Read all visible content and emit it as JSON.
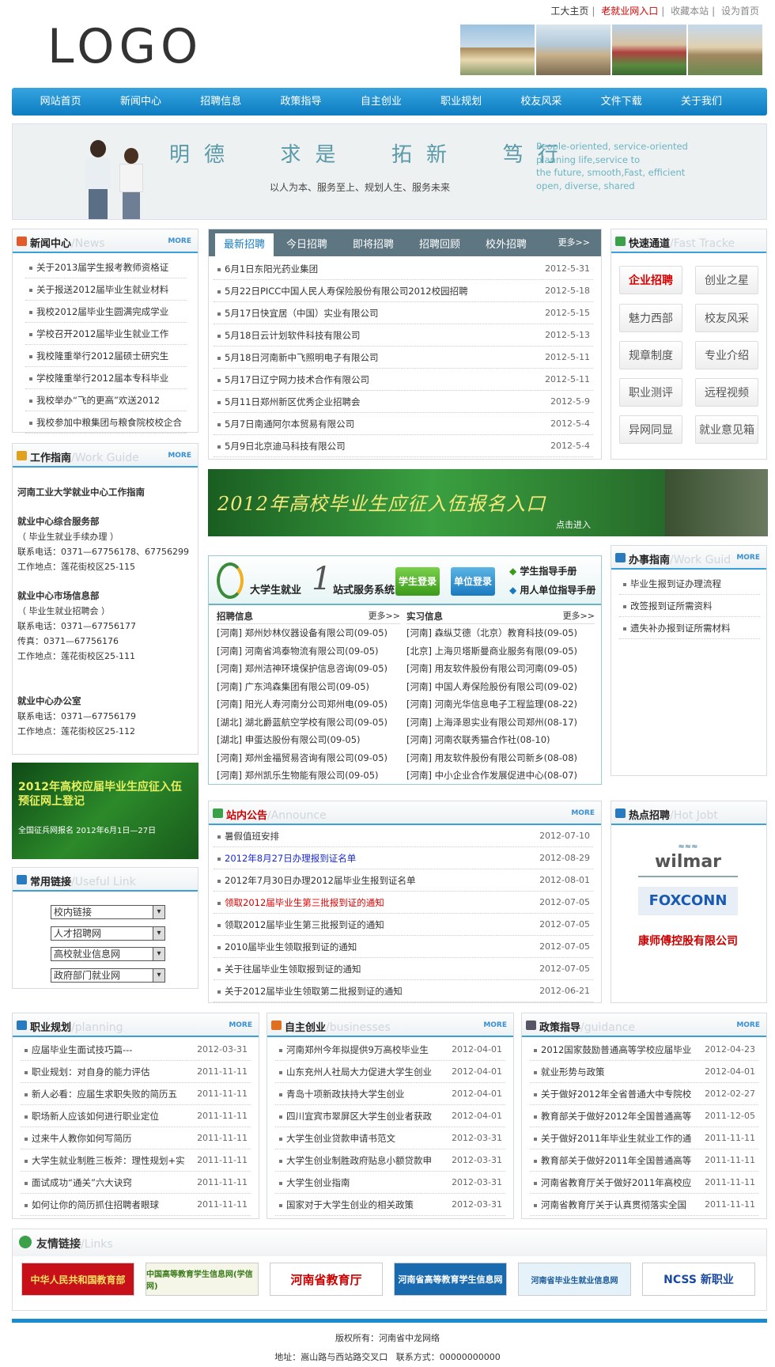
{
  "header": {
    "links": [
      "工大主页",
      "老就业网入口",
      "收藏本站",
      "设为首页"
    ],
    "logo": "LOGO"
  },
  "nav": [
    "网站首页",
    "新闻中心",
    "招聘信息",
    "政策指导",
    "自主创业",
    "职业规划",
    "校友风采",
    "文件下载",
    "关于我们"
  ],
  "banner": {
    "slogan": "明德  求是  拓新  笃行",
    "subtitle": "以人为本、服务至上、规划人生、服务未来",
    "en_lines": [
      "People-oriented, service-oriented",
      "planning life,service to",
      "the future, smooth,Fast, efficient",
      "open, diverse, shared"
    ]
  },
  "news": {
    "title": "新闻中心",
    "en": "/News",
    "more": "MORE",
    "items": [
      "关于2013届学生报考教师资格证",
      "关于报送2012届毕业生就业材料",
      "我校2012届毕业生圆满完成学业",
      "学校召开2012届毕业生就业工作",
      "我校隆重举行2012届硕士研究生",
      "学校隆重举行2012届本专科毕业",
      "我校举办“飞的更高”欢送2012",
      "我校参加中粮集团与粮食院校校企合"
    ]
  },
  "recruit": {
    "tabs": [
      "最新招聘",
      "今日招聘",
      "即将招聘",
      "招聘回顾",
      "校外招聘"
    ],
    "more": "更多>>",
    "items": [
      {
        "t": "6月1日东阳光药业集团",
        "d": "2012-5-31"
      },
      {
        "t": "5月22日PICC中国人民人寿保险股份有限公司2012校园招聘",
        "d": "2012-5-18"
      },
      {
        "t": "5月17日快宜居（中国）实业有限公司",
        "d": "2012-5-15"
      },
      {
        "t": "5月18日云计划软件科技有限公司",
        "d": "2012-5-13"
      },
      {
        "t": "5月18日河南新中飞照明电子有限公司",
        "d": "2012-5-11"
      },
      {
        "t": "5月17日辽宁网力技术合作有限公司",
        "d": "2012-5-11"
      },
      {
        "t": "5月11日郑州新区优秀企业招聘会",
        "d": "2012-5-9"
      },
      {
        "t": "5月7日南通阿尔本贸易有限公司",
        "d": "2012-5-4"
      },
      {
        "t": "5月9日北京迪马科技有限公司",
        "d": "2012-5-4"
      }
    ]
  },
  "quick": {
    "title": "快速通道",
    "en": "/Fast Tracke",
    "buttons": [
      "企业招聘",
      "创业之星",
      "魅力西部",
      "校友风采",
      "规章制度",
      "专业介绍",
      "职业测评",
      "远程视频",
      "异网同显",
      "就业意见箱"
    ]
  },
  "guide": {
    "title": "工作指南",
    "en": "/Work Guide",
    "more": "MORE",
    "heading": "河南工业大学就业中心工作指南",
    "sections": [
      {
        "name": "就业中心综合服务部",
        "lines": [
          "（ 毕业生就业手续办理 ）",
          "联系电话：0371—67756178、67756299",
          "工作地点：莲花街校区25-115"
        ]
      },
      {
        "name": "就业中心市场信息部",
        "lines": [
          "（ 毕业生就业招聘会 ）",
          "联系电话：0371—67756177",
          "传真：0371—67756176",
          "工作地点：莲花街校区25-111"
        ]
      },
      {
        "name": "就业中心办公室",
        "lines": [
          "联系电话：0371—67756179",
          "工作地点：莲花街校区25-112"
        ]
      }
    ]
  },
  "army_banner": {
    "main": "2012年高校毕业生应征入伍报名入口",
    "sub": "点击进入"
  },
  "service": {
    "name": "大学生就业",
    "name2": "站式服务系统",
    "btn_student": "学生登录",
    "btn_unit": "单位登录",
    "manual_student": "学生指导手册",
    "manual_unit": "用人单位指导手册",
    "col1": {
      "title": "招聘信息",
      "more": "更多>>",
      "items": [
        "[河南] 郑州妙林仪器设备有限公司(09-05)",
        "[河南] 河南省鸿泰物流有限公司(09-05)",
        "[河南] 郑州洁神环境保护信息咨询(09-05)",
        "[河南] 广东鸿森集团有限公司(09-05)",
        "[河南] 阳光人寿河南分公司郑州电(09-05)",
        "[湖北] 湖北爵蓝航空学校有限公司(09-05)",
        "[湖北] 申蛋达股份有限公司(09-05)",
        "[河南] 郑州金福贸易咨询有限公司(09-05)",
        "[河南] 郑州凯乐生物能有限公司(09-05)"
      ]
    },
    "col2": {
      "title": "实习信息",
      "more": "更多>>",
      "items": [
        "[河南] 森纵艾德（北京）教育科技(09-05)",
        "[北京] 上海贝塔斯曼商业服务有限(09-05)",
        "[河南] 用友软件股份有限公司河南(09-05)",
        "[河南] 中国人寿保险股份有限公司(09-02)",
        "[河南] 河南光华信息电子工程监理(08-22)",
        "[河南] 上海泽恩实业有限公司郑州(08-17)",
        "[河南] 河南农联秀猫合作社(08-10)",
        "[河南] 用友软件股份有限公司新乡(08-08)",
        "[河南] 中小企业合作发展促进中心(08-07)"
      ]
    }
  },
  "office": {
    "title": "办事指南",
    "en": "/Work Guid",
    "more": "MORE",
    "items": [
      "毕业生报到证办理流程",
      "改签报到证所需资料",
      "遗失补办报到证所需材料"
    ]
  },
  "left_banner": {
    "main": "2012年高校应届毕业生应征入伍预征网上登记",
    "sub": "全国征兵网报名 2012年6月1日—27日"
  },
  "useful": {
    "title": "常用链接",
    "en": "/Useful Link",
    "selects": [
      "校内链接",
      "人才招聘网",
      "高校就业信息网",
      "政府部门就业网"
    ]
  },
  "announce": {
    "title": "站内公告",
    "en": "/Announce",
    "more": "MORE",
    "items": [
      {
        "t": "暑假值班安排",
        "d": "2012-07-10"
      },
      {
        "t": "2012年8月27日办理报到证名单",
        "d": "2012-08-29"
      },
      {
        "t": "2012年7月30日办理2012届毕业生报到证名单",
        "d": "2012-08-01"
      },
      {
        "t": "领取2012届毕业生第三批报到证的通知",
        "d": "2012-07-05"
      },
      {
        "t": "领取2012届毕业生第三批报到证的通知",
        "d": "2012-07-05"
      },
      {
        "t": "2010届毕业生领取报到证的通知",
        "d": "2012-07-05"
      },
      {
        "t": "关于往届毕业生领取报到证的通知",
        "d": "2012-07-05"
      },
      {
        "t": "关于2012届毕业生领取第二批报到证的通知",
        "d": "2012-06-21"
      }
    ]
  },
  "hot": {
    "title": "热点招聘",
    "en": "/Hot Jobt",
    "logos": [
      "wilmar",
      "FOXCONN",
      "康师傅控股有限公司"
    ]
  },
  "career": {
    "title": "职业规划",
    "en": "/planning",
    "more": "MORE",
    "items": [
      {
        "t": "应届毕业生面试技巧篇---",
        "d": "2012-03-31"
      },
      {
        "t": "职业规划：对自身的能力评估",
        "d": "2011-11-11"
      },
      {
        "t": "新人必看：应届生求职失败的简历五",
        "d": "2011-11-11"
      },
      {
        "t": "职场新人应该如何进行职业定位",
        "d": "2011-11-11"
      },
      {
        "t": "过来牛人教你如何写简历",
        "d": "2011-11-11"
      },
      {
        "t": "大学生就业制胜三板斧：理性规划+实",
        "d": "2011-11-11"
      },
      {
        "t": "面试成功“通关”六大诀窍",
        "d": "2011-11-11"
      },
      {
        "t": "如何让你的简历抓住招聘者眼球",
        "d": "2011-11-11"
      }
    ]
  },
  "startup": {
    "title": "自主创业",
    "en": "/businesses",
    "more": "MORE",
    "items": [
      {
        "t": "河南郑州今年拟提供9万高校毕业生",
        "d": "2012-04-01"
      },
      {
        "t": "山东充州人社局大力促进大学生创业",
        "d": "2012-04-01"
      },
      {
        "t": "青岛十项新政扶持大学生创业",
        "d": "2012-04-01"
      },
      {
        "t": "四川宜宾市翠屏区大学生创业者获政",
        "d": "2012-04-01"
      },
      {
        "t": "大学生创业贷款申请书范文",
        "d": "2012-03-31"
      },
      {
        "t": "大学生创业制胜政府贴息小额贷款申",
        "d": "2012-03-31"
      },
      {
        "t": "大学生创业指南",
        "d": "2012-03-31"
      },
      {
        "t": "国家对于大学生创业的相关政策",
        "d": "2012-03-31"
      }
    ]
  },
  "policy": {
    "title": "政策指导",
    "en": "/guidance",
    "more": "MORE",
    "items": [
      {
        "t": "2012国家鼓励普通高等学校应届毕业",
        "d": "2012-04-23"
      },
      {
        "t": "就业形势与政策",
        "d": "2012-04-01"
      },
      {
        "t": "关于做好2012年全省普通大中专院校",
        "d": "2012-02-27"
      },
      {
        "t": "教育部关于做好2012年全国普通高等",
        "d": "2011-12-05"
      },
      {
        "t": "关于做好2011年毕业生就业工作的通",
        "d": "2011-11-11"
      },
      {
        "t": "教育部关于做好2011年全国普通高等",
        "d": "2011-11-11"
      },
      {
        "t": "河南省教育厅关于做好2011年高校应",
        "d": "2011-11-11"
      },
      {
        "t": "河南省教育厅关于认真贯彻落实全国",
        "d": "2011-11-11"
      }
    ]
  },
  "friends": {
    "title": "友情链接",
    "en": "/Links",
    "items": [
      "中华人民共和国教育部",
      "中国高等教育学生信息网(学信网)",
      "河南省教育厅",
      "河南省高等教育学生信息网",
      "河南省毕业生就业信息网",
      "NCSS 新职业"
    ]
  },
  "footer": {
    "copyright": "版权所有：河南省中龙网络",
    "address": "地址：嵩山路与西站路交叉口   联系方式：00000000000"
  },
  "colors": {
    "nav": "#1b8bd0",
    "accent": "#3aa0d8",
    "red": "#dd1111",
    "green": "#1f7a2a"
  }
}
